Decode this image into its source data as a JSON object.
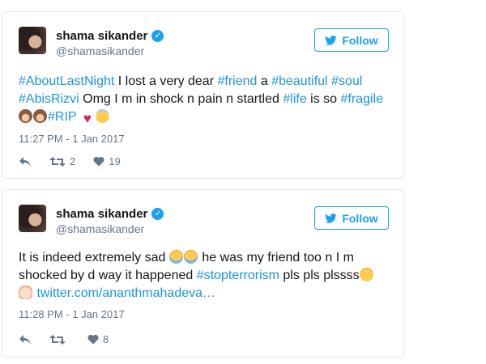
{
  "tweets": [
    {
      "user": {
        "name": "shama sikander",
        "handle": "@shamasikander",
        "verified": true
      },
      "follow_label": "Follow",
      "content": {
        "t1": "#AboutLastNight",
        "t2": " I lost a very dear ",
        "t3": "#friend",
        "t4": " a ",
        "t5": "#beautiful",
        "t6": " ",
        "t7": "#soul",
        "t8": "#AbisRizvi",
        "t9": " Omg I m in shock n pain n startled ",
        "t10": "#life",
        "t11": " is so ",
        "t12": "#fragile",
        "t13": "#RIP"
      },
      "timestamp": "11:27 PM - 1 Jan 2017",
      "retweets": "2",
      "likes": "19"
    },
    {
      "user": {
        "name": "shama sikander",
        "handle": "@shamasikander",
        "verified": true
      },
      "follow_label": "Follow",
      "content": {
        "t1": "It is indeed extremely sad ",
        "t2": " he was my friend too n I m",
        "t3": "shocked by d way it happened ",
        "t4": "#stopterrorism",
        "t5": " pls pls plssss",
        "link": "twitter.com/ananthmahadeva…"
      },
      "timestamp": "11:28 PM - 1 Jan 2017",
      "retweets": "",
      "likes": "8"
    }
  ],
  "colors": {
    "accent": "#1da1f2",
    "hashtag": "#1b95e0",
    "muted": "#657786",
    "border": "#e1e8ed"
  },
  "icons": [
    "avatar",
    "verified-icon",
    "twitter-bird-icon",
    "reply-icon",
    "retweet-icon",
    "heart-icon",
    "emoji"
  ]
}
